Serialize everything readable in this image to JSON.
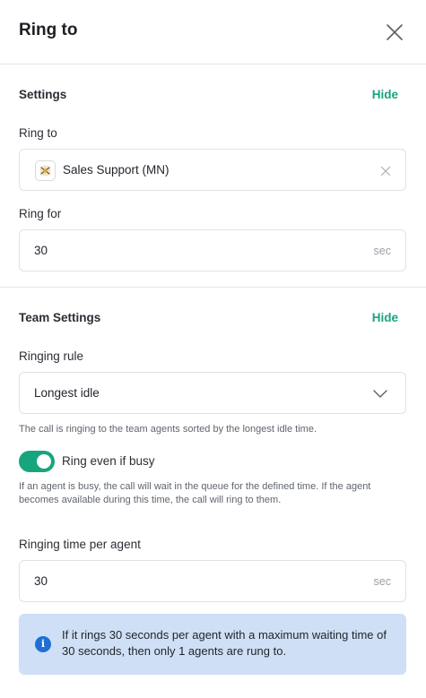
{
  "header": {
    "title": "Ring to",
    "close_icon": "close-icon"
  },
  "settings": {
    "title": "Settings",
    "hide_label": "Hide",
    "ring_to_label": "Ring to",
    "ring_to_value": "Sales Support (MN)",
    "ring_to_icon": "team-icon",
    "ring_for_label": "Ring for",
    "ring_for_value": "30",
    "ring_for_unit": "sec"
  },
  "team_settings": {
    "title": "Team Settings",
    "hide_label": "Hide",
    "ringing_rule_label": "Ringing rule",
    "ringing_rule_value": "Longest idle",
    "ringing_rule_help": "The call is ringing to the team agents sorted by the longest idle time.",
    "ring_even_if_busy_label": "Ring even if busy",
    "ring_even_if_busy_on": true,
    "ring_even_if_busy_help": "If an agent is busy, the call will wait in the queue for the defined time. If the agent becomes available during this time, the call will ring to them.",
    "ringing_time_label": "Ringing time per agent",
    "ringing_time_value": "30",
    "ringing_time_unit": "sec",
    "info_text": "If it rings 30 seconds per agent with a maximum waiting time of 30 seconds, then only 1 agents are rung to.",
    "info_icon": "info-icon"
  },
  "colors": {
    "accent": "#17a57e",
    "info_bg": "#cfe0f6",
    "info_icon": "#1f6fd6",
    "border": "#dfe2e6"
  }
}
